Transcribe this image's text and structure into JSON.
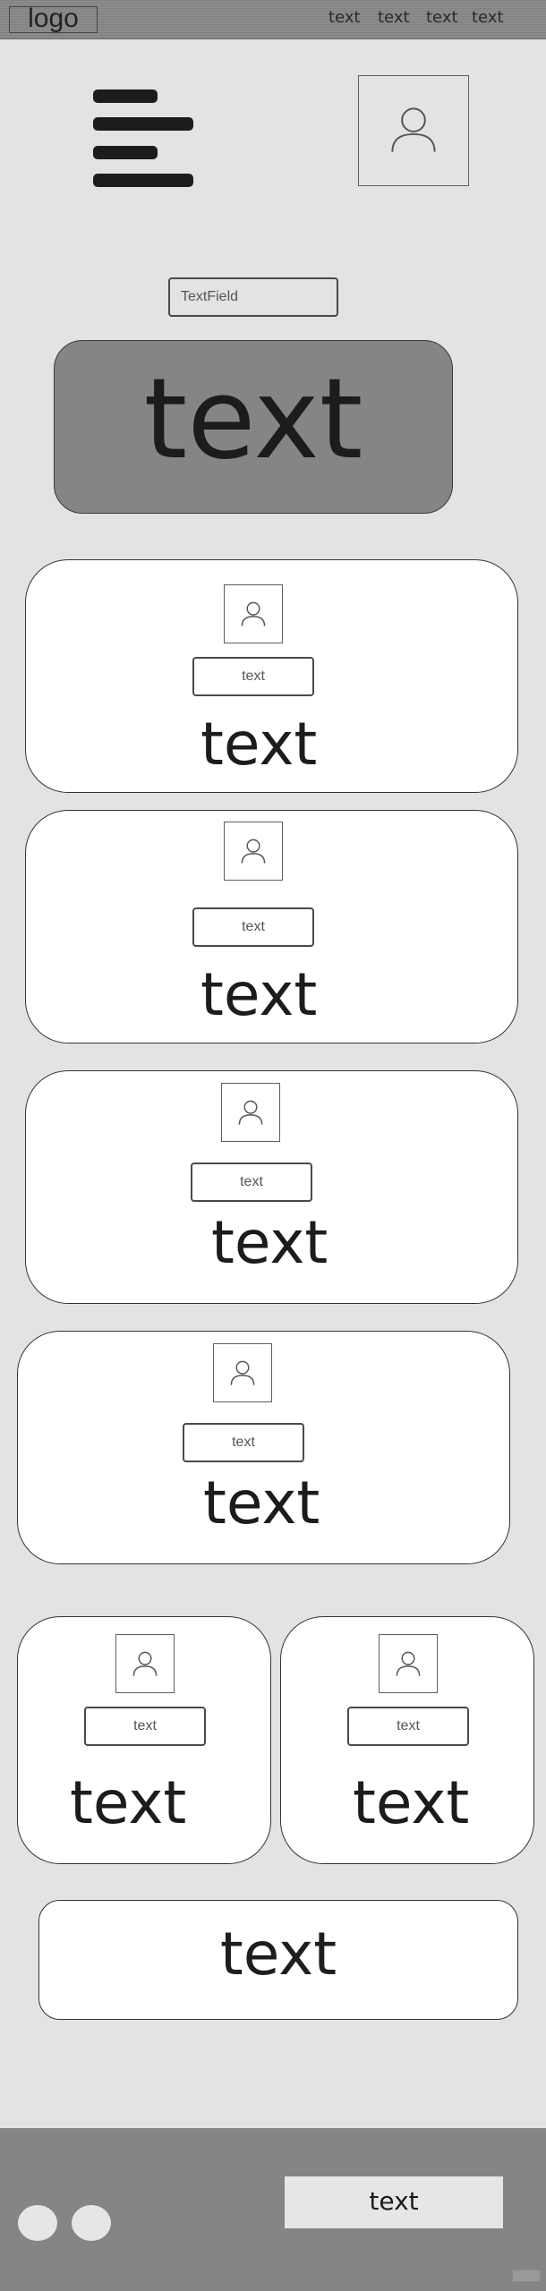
{
  "header": {
    "logo_text": "logo",
    "nav": [
      "text",
      "text",
      "text",
      "text"
    ]
  },
  "hero": {
    "text_field_label": "TextField",
    "banner_text": "text"
  },
  "cards": [
    {
      "button_label": "text",
      "text": "text"
    },
    {
      "button_label": "text",
      "text": "text"
    },
    {
      "button_label": "text",
      "text": "text"
    },
    {
      "button_label": "text",
      "text": "text"
    },
    {
      "button_label": "text",
      "text": "text"
    },
    {
      "button_label": "text",
      "text": "text"
    }
  ],
  "wide_card": {
    "text": "text"
  },
  "footer": {
    "button_label": "text"
  },
  "icons": {
    "menu": "hamburger-icon",
    "profile": "user-icon",
    "card_image": "user-icon"
  },
  "colors": {
    "page_bg": "#e3e3e3",
    "header_bg": "#8a8a8a",
    "hero_bg": "#858585",
    "card_bg": "#ffffff",
    "footer_bg": "#858585"
  }
}
